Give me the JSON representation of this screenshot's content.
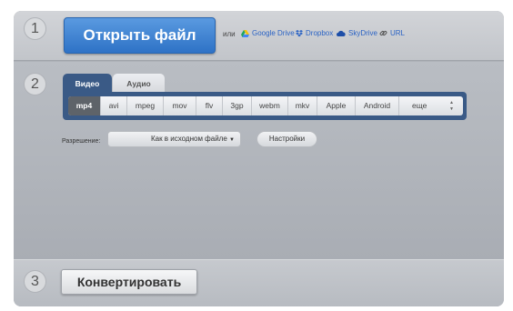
{
  "steps": {
    "one": "1",
    "two": "2",
    "three": "3"
  },
  "open_file": {
    "label": "Открыть файл"
  },
  "sources": {
    "or_label": "или",
    "google_drive": "Google Drive",
    "dropbox": "Dropbox",
    "skydrive": "SkyDrive",
    "url": "URL"
  },
  "tabs": {
    "video": "Видео",
    "audio": "Аудио"
  },
  "formats": {
    "items": [
      "mp4",
      "avi",
      "mpeg",
      "mov",
      "flv",
      "3gp",
      "webm",
      "mkv",
      "Apple",
      "Android"
    ],
    "more": "еще",
    "selected": "mp4"
  },
  "resolution": {
    "label": "Разрешение:",
    "value": "Как в исходном файле"
  },
  "settings": {
    "label": "Настройки"
  },
  "convert": {
    "label": "Конвертировать"
  },
  "colors": {
    "primary_button": "#3a7fd4",
    "tab_active": "#3a5a86",
    "link": "#2b63c4"
  }
}
